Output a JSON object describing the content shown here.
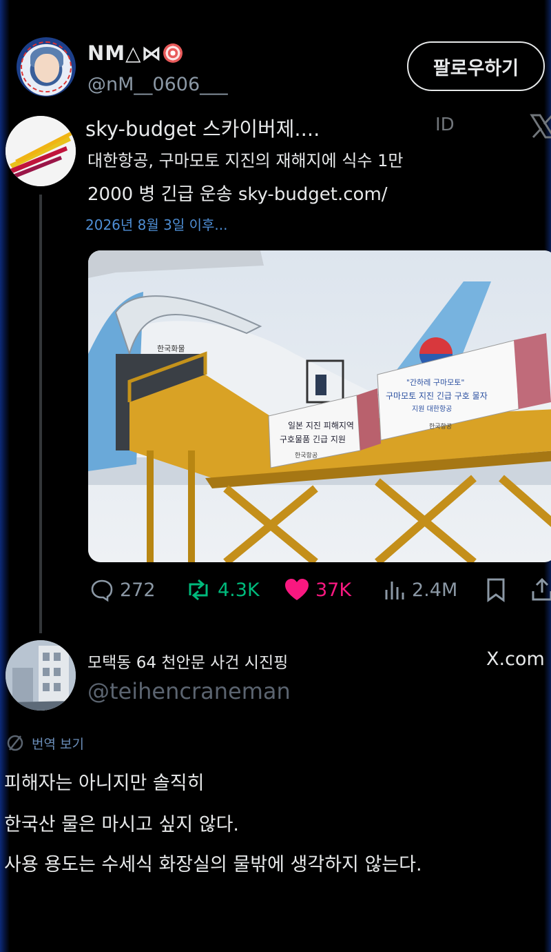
{
  "author": {
    "name": "NM△⋈",
    "handle": "@nM__0606___",
    "follow_label": "팔로우하기"
  },
  "quoted_card": {
    "title": "sky-budget 스카이버제....",
    "badge": "ID",
    "desc_line1": "대한항공, 구마모토 지진의 재해지에 식수 1만",
    "desc_line2": "2000 병 긴급 운송 sky-budget.com/",
    "date": "2026년 8월 3일 이후...",
    "photo_banner1_lines": [
      "일본 지진 피해지역",
      "구호물품 긴급 지원",
      "한국항공"
    ],
    "photo_banner2_lines": [
      "\"간하레 구마모토\"",
      "구마모토 지진 긴급 구호 물자",
      "지원 대한항공",
      "한국항공"
    ],
    "photo_fuselage_text": "한국화물"
  },
  "actions": {
    "replies": "272",
    "reposts": "4.3K",
    "likes": "37K",
    "views": "2.4M"
  },
  "reply": {
    "name": "모택동 64 천안문 사건 시진핑",
    "handle": "@teihencraneman",
    "source": "X.com",
    "translate_label": "번역 보기",
    "lines": [
      "피해자는 아니지만 솔직히",
      "한국산 물은 마시고 싶지 않다.",
      "사용 용도는 수세식 화장실의 물밖에 생각하지 않는다."
    ]
  },
  "colors": {
    "background": "#000000",
    "text": "#e7e9ea",
    "muted": "#8b98a5",
    "link": "#4f8fd6",
    "repost": "#00ba7c",
    "like": "#f91880"
  },
  "icons": [
    "reply-icon",
    "repost-icon",
    "heart-icon",
    "views-icon",
    "bookmark-icon",
    "share-icon",
    "x-logo-icon",
    "translate-icon"
  ]
}
